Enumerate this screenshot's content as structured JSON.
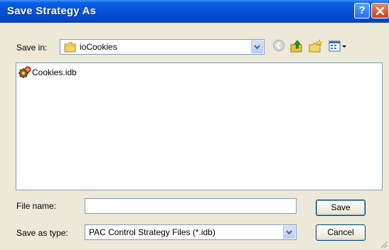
{
  "window": {
    "title": "Save Strategy As"
  },
  "titlebar": {
    "help_label": "?"
  },
  "save_in": {
    "label": "Save in:",
    "value": "ioCookies"
  },
  "toolbar": {
    "icons": [
      "back-icon",
      "up-folder-icon",
      "new-folder-icon",
      "view-menu-icon"
    ]
  },
  "files": [
    {
      "name": "Cookies.idb",
      "icon": "strategy-file-icon"
    }
  ],
  "file_name": {
    "label": "File name:",
    "value": ""
  },
  "save_as_type": {
    "label": "Save as type:",
    "value": "PAC Control Strategy Files (*.idb)"
  },
  "buttons": {
    "save": "Save",
    "cancel": "Cancel"
  },
  "colors": {
    "titlebar": "#0551d8",
    "dialog_bg": "#ece9d8",
    "field_border": "#7f9db9",
    "close_button": "#c84018"
  }
}
